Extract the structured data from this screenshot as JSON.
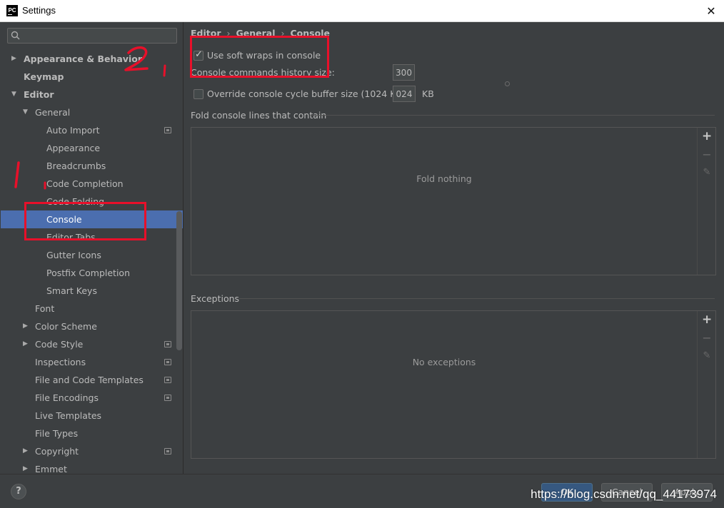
{
  "window": {
    "app_logo_text": "PC",
    "title": "Settings",
    "close_glyph": "✕"
  },
  "sidebar": {
    "search": {
      "value": "",
      "placeholder": ""
    },
    "items": [
      {
        "label": "Appearance & Behavior",
        "level": 0,
        "arrow": "▶",
        "bold": true
      },
      {
        "label": "Keymap",
        "level": 0,
        "arrow": "",
        "bold": true
      },
      {
        "label": "Editor",
        "level": 0,
        "arrow": "▼",
        "bold": true
      },
      {
        "label": "General",
        "level": 1,
        "arrow": "▼"
      },
      {
        "label": "Auto Import",
        "level": 2,
        "arrow": "",
        "project_icon": true
      },
      {
        "label": "Appearance",
        "level": 2,
        "arrow": ""
      },
      {
        "label": "Breadcrumbs",
        "level": 2,
        "arrow": ""
      },
      {
        "label": "Code Completion",
        "level": 2,
        "arrow": ""
      },
      {
        "label": "Code Folding",
        "level": 2,
        "arrow": ""
      },
      {
        "label": "Console",
        "level": 2,
        "arrow": "",
        "selected": true
      },
      {
        "label": "Editor Tabs",
        "level": 2,
        "arrow": ""
      },
      {
        "label": "Gutter Icons",
        "level": 2,
        "arrow": ""
      },
      {
        "label": "Postfix Completion",
        "level": 2,
        "arrow": ""
      },
      {
        "label": "Smart Keys",
        "level": 2,
        "arrow": ""
      },
      {
        "label": "Font",
        "level": 1,
        "arrow": ""
      },
      {
        "label": "Color Scheme",
        "level": 1,
        "arrow": "▶"
      },
      {
        "label": "Code Style",
        "level": 1,
        "arrow": "▶",
        "project_icon": true
      },
      {
        "label": "Inspections",
        "level": 1,
        "arrow": "",
        "project_icon": true
      },
      {
        "label": "File and Code Templates",
        "level": 1,
        "arrow": "",
        "project_icon": true
      },
      {
        "label": "File Encodings",
        "level": 1,
        "arrow": "",
        "project_icon": true
      },
      {
        "label": "Live Templates",
        "level": 1,
        "arrow": ""
      },
      {
        "label": "File Types",
        "level": 1,
        "arrow": ""
      },
      {
        "label": "Copyright",
        "level": 1,
        "arrow": "▶",
        "project_icon": true
      },
      {
        "label": "Emmet",
        "level": 1,
        "arrow": "▶"
      }
    ]
  },
  "content": {
    "breadcrumb": [
      "Editor",
      "General",
      "Console"
    ],
    "breadcrumb_sep": "›",
    "soft_wraps": {
      "label": "Use soft wraps in console",
      "checked": true
    },
    "history_size": {
      "label": "Console commands history size:",
      "value": "300"
    },
    "override_buffer": {
      "label": "Override console cycle buffer size (1024 KB)",
      "checked": false,
      "value": "024",
      "unit": "KB"
    },
    "fold_section": {
      "title": "Fold console lines that contain",
      "empty_text": "Fold nothing"
    },
    "exceptions_section": {
      "title": "Exceptions",
      "empty_text": "No exceptions"
    },
    "toolbar": {
      "add": "+",
      "remove": "−",
      "edit": "✎"
    }
  },
  "footer": {
    "help": "?",
    "ok": "OK",
    "cancel": "Cancel",
    "apply": "Apply"
  },
  "watermark": "https://blog.csdn.net/qq_44173974",
  "colors": {
    "accent_selection": "#4b6eaf",
    "annotation_red": "#e8102a",
    "background": "#3c3f41"
  }
}
